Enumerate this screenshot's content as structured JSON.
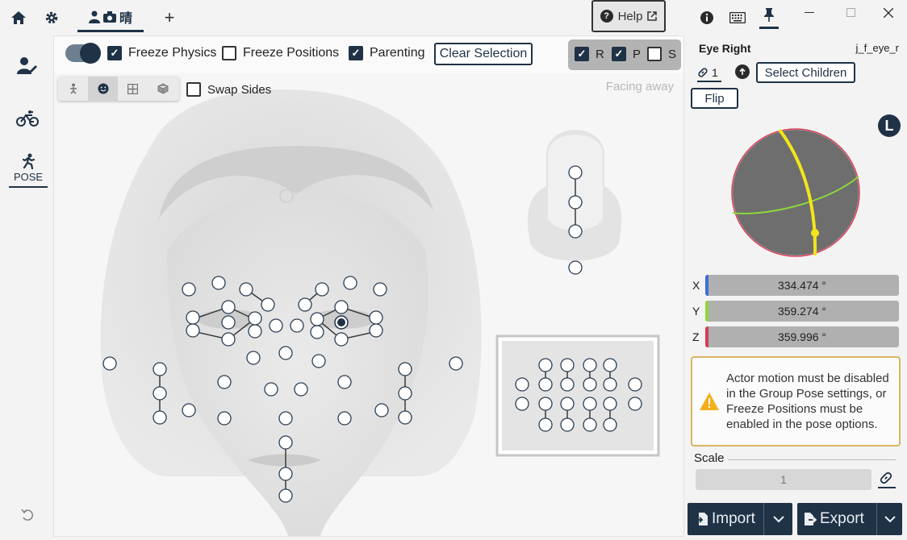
{
  "topbar": {
    "tab_label": "晴",
    "help_label": "Help"
  },
  "left_rail": {
    "pose_label": "POSE"
  },
  "toolbar": {
    "freeze_physics": "Freeze Physics",
    "freeze_positions": "Freeze Positions",
    "parenting": "Parenting",
    "clear_selection": "Clear Selection",
    "r_label": "R",
    "p_label": "P",
    "s_label": "S"
  },
  "viewport": {
    "swap_sides": "Swap Sides",
    "facing": "Facing away"
  },
  "right_panel": {
    "title": "Eye Right",
    "bone_id": "j_f_eye_r",
    "link_count": "1",
    "select_children": "Select Children",
    "flip": "Flip",
    "space_badge": "L",
    "x_label": "X",
    "y_label": "Y",
    "z_label": "Z",
    "x_value": "334.474 °",
    "y_value": "359.274 °",
    "z_value": "359.996 °",
    "warning": "Actor motion must be disabled in the Group Pose settings, or Freeze Positions must be enabled in the pose options.",
    "scale_label": "Scale",
    "scale_value": "1",
    "import_label": "Import",
    "export_label": "Export"
  },
  "colors": {
    "accent": "#1f3246",
    "x_axis": "#3b6fd6",
    "y_axis": "#8fd63b",
    "z_axis": "#d63b55",
    "warning_border": "#d8b560",
    "warning_icon": "#f2b01e"
  }
}
